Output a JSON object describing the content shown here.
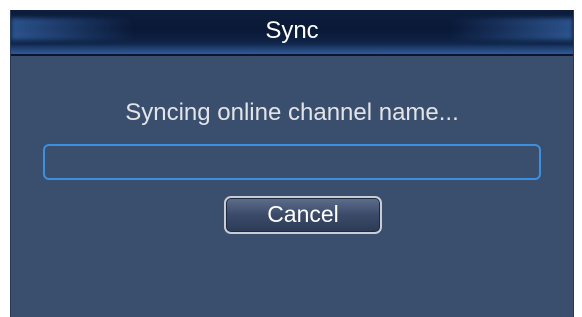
{
  "dialog": {
    "title": "Sync",
    "message": "Syncing online channel name...",
    "progress": 0,
    "cancel_label": "Cancel"
  },
  "colors": {
    "dialog_background": "#3a4e6e",
    "titlebar": "#0d1e3d",
    "progress_border": "#3d8fe0",
    "text": "#e2e4e8"
  }
}
